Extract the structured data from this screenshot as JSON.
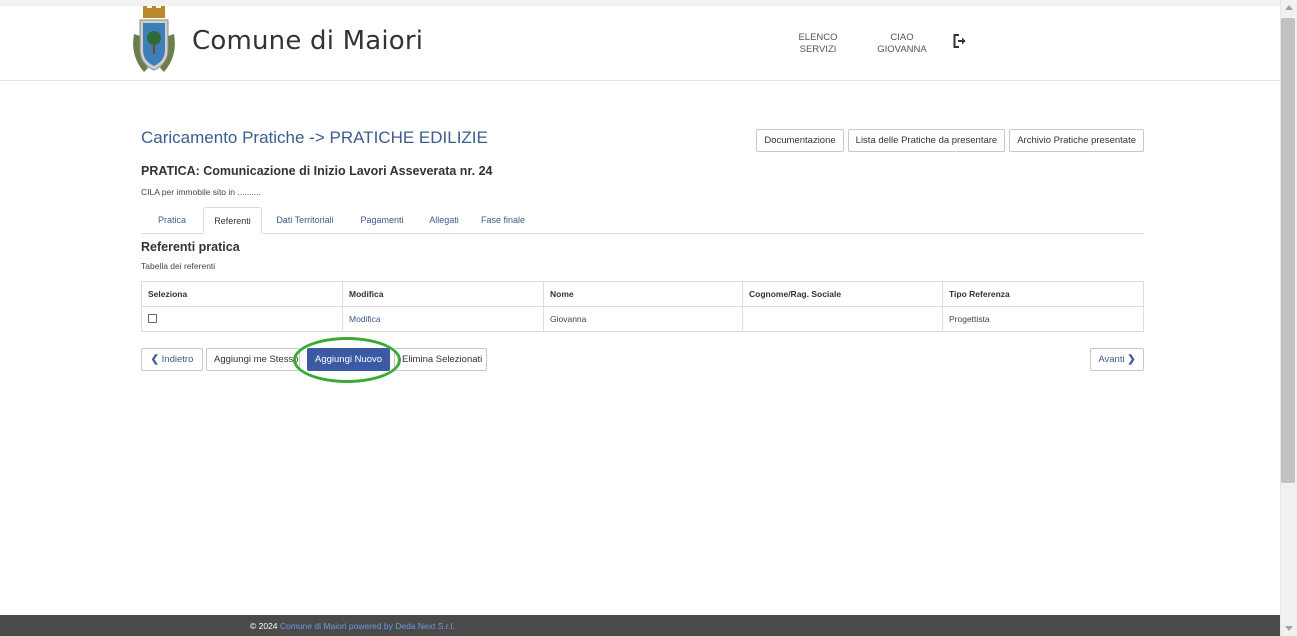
{
  "header": {
    "brand": "Comune di Maiori",
    "nav_services_line1": "ELENCO",
    "nav_services_line2": "SERVIZI",
    "nav_user_line1": "CIAO",
    "nav_user_line2": "GIOVANNA",
    "logout_icon": "logout-icon"
  },
  "page": {
    "title": "Caricamento Pratiche -> PRATICHE EDILIZIE",
    "buttons": {
      "documentazione": "Documentazione",
      "lista": "Lista delle Pratiche da presentare",
      "archivio": "Archivio Pratiche presentate"
    },
    "pratica_title": "PRATICA: Comunicazione di Inizio Lavori Asseverata nr. 24",
    "pratica_sub": "CILA per immobile sito in .........."
  },
  "tabs": [
    "Pratica",
    "Referenti",
    "Dati Territoriali",
    "Pagamenti",
    "Allegati",
    "Fase finale"
  ],
  "active_tab": "Referenti",
  "section": {
    "title": "Referenti pratica",
    "subtitle": "Tabella dei referenti"
  },
  "table": {
    "headers": [
      "Seleziona",
      "Modifica",
      "Nome",
      "Cognome/Rag. Sociale",
      "Tipo Referenza"
    ],
    "rows": [
      {
        "modifica": "Modifica",
        "nome": "Giovanna",
        "cognome": "",
        "tipo": "Progettista"
      }
    ]
  },
  "actions": {
    "indietro": "Indietro",
    "aggiungi_me": "Aggiungi me Stesso",
    "aggiungi_nuovo": "Aggiungi Nuovo",
    "elimina": "Elimina Selezionati",
    "avanti": "Avanti"
  },
  "footer": {
    "copyright": "© 2024",
    "link_text": "Comune di Maiori powered by Deda Next S.r.l."
  },
  "colors": {
    "accent": "#3d5c8f",
    "primary_button": "#3a5ba3",
    "highlight_circle": "#3aaa35",
    "footer_bg": "#4a4a4a"
  }
}
